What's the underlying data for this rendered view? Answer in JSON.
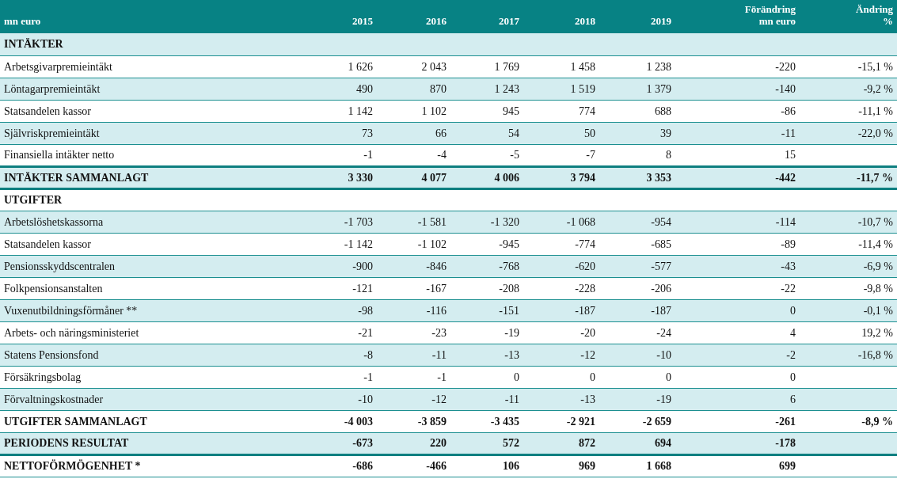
{
  "table": {
    "columns": [
      "mn euro",
      "2015",
      "2016",
      "2017",
      "2018",
      "2019",
      "Förändring\nmn euro",
      "Ändring\n%"
    ],
    "rows": [
      {
        "kind": "section",
        "label": "INTÄKTER",
        "values": [],
        "thick_rule_below": false
      },
      {
        "kind": "item",
        "label": "Arbetsgivarpremieintäkt",
        "values": [
          "1 626",
          "2 043",
          "1 769",
          "1 458",
          "1 238",
          "-220",
          "-15,1 %"
        ],
        "thick_rule_below": false
      },
      {
        "kind": "item",
        "label": "Löntagarpremieintäkt",
        "values": [
          "490",
          "870",
          "1 243",
          "1 519",
          "1 379",
          "-140",
          "-9,2 %"
        ],
        "thick_rule_below": false
      },
      {
        "kind": "item",
        "label": "Statsandelen kassor",
        "values": [
          "1 142",
          "1 102",
          "945",
          "774",
          "688",
          "-86",
          "-11,1 %"
        ],
        "thick_rule_below": false
      },
      {
        "kind": "item",
        "label": "Självriskpremieintäkt",
        "values": [
          "73",
          "66",
          "54",
          "50",
          "39",
          "-11",
          "-22,0 %"
        ],
        "thick_rule_below": false
      },
      {
        "kind": "item",
        "label": "Finansiella intäkter netto",
        "values": [
          "-1",
          "-4",
          "-5",
          "-7",
          "8",
          "15"
        ],
        "thick_rule_below": true
      },
      {
        "kind": "total",
        "label": "INTÄKTER SAMMANLAGT",
        "values": [
          "3 330",
          "4 077",
          "4 006",
          "3 794",
          "3 353",
          "-442",
          "-11,7 %"
        ],
        "thick_rule_below": true
      },
      {
        "kind": "section",
        "label": "UTGIFTER",
        "values": [],
        "thick_rule_below": false
      },
      {
        "kind": "item",
        "label": "Arbetslöshetskassorna",
        "values": [
          "-1 703",
          "-1 581",
          "-1 320",
          "-1 068",
          "-954",
          "-114",
          "-10,7 %"
        ],
        "thick_rule_below": false
      },
      {
        "kind": "item",
        "label": "Statsandelen kassor",
        "values": [
          "-1 142",
          "-1 102",
          "-945",
          "-774",
          "-685",
          "-89",
          "-11,4 %"
        ],
        "thick_rule_below": false
      },
      {
        "kind": "item",
        "label": "Pensionsskyddscentralen",
        "values": [
          "-900",
          "-846",
          "-768",
          "-620",
          "-577",
          "-43",
          "-6,9 %"
        ],
        "thick_rule_below": false
      },
      {
        "kind": "item",
        "label": "Folkpensionsanstalten",
        "values": [
          "-121",
          "-167",
          "-208",
          "-228",
          "-206",
          "-22",
          "-9,8 %"
        ],
        "thick_rule_below": false
      },
      {
        "kind": "item",
        "label": "Vuxenutbildningsförmåner **",
        "values": [
          "-98",
          "-116",
          "-151",
          "-187",
          "-187",
          "0",
          "-0,1 %"
        ],
        "thick_rule_below": false
      },
      {
        "kind": "item",
        "label": "Arbets- och näringsministeriet",
        "values": [
          "-21",
          "-23",
          "-19",
          "-20",
          "-24",
          "4",
          "19,2 %"
        ],
        "thick_rule_below": false
      },
      {
        "kind": "item",
        "label": "Statens Pensionsfond",
        "values": [
          "-8",
          "-11",
          "-13",
          "-12",
          "-10",
          "-2",
          "-16,8 %"
        ],
        "thick_rule_below": false
      },
      {
        "kind": "item",
        "label": "Försäkringsbolag",
        "values": [
          "-1",
          "-1",
          "0",
          "0",
          "0",
          "0"
        ],
        "thick_rule_below": false
      },
      {
        "kind": "item",
        "label": "Förvaltningskostnader",
        "values": [
          "-10",
          "-12",
          "-11",
          "-13",
          "-19",
          "6"
        ],
        "thick_rule_below": false
      },
      {
        "kind": "total",
        "label": "UTGIFTER SAMMANLAGT",
        "values": [
          "-4 003",
          "-3 859",
          "-3 435",
          "-2 921",
          "-2 659",
          "-261",
          "-8,9 %"
        ],
        "thick_rule_below": false
      },
      {
        "kind": "total",
        "label": "PERIODENS RESULTAT",
        "values": [
          "-673",
          "220",
          "572",
          "872",
          "694",
          "-178"
        ],
        "thick_rule_below": true
      },
      {
        "kind": "total",
        "label": "NETTOFÖRMÖGENHET *",
        "values": [
          "-686",
          "-466",
          "106",
          "969",
          "1 668",
          "699"
        ],
        "thick_rule_below": false
      }
    ]
  }
}
